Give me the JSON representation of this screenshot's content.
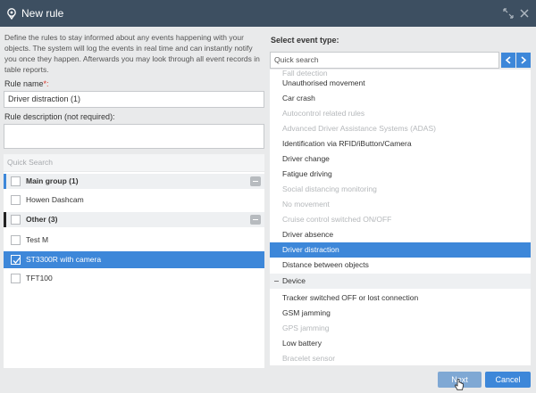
{
  "window": {
    "title": "New rule",
    "pin_icon": "location-pin-icon",
    "expand_icon": "expand-icon",
    "close_icon": "close-icon"
  },
  "description": "Define the rules to stay informed about any events happening with your objects. The system will log the events in real time and can instantly notify you once they happen. Afterwards you may look through all event records in table reports.",
  "rule_name": {
    "label": "Rule name",
    "required_mark": "*:",
    "value": "Driver distraction (1)"
  },
  "rule_description": {
    "label": "Rule description (not required):",
    "value": ""
  },
  "objects": {
    "search_placeholder": "Quick Search",
    "rows": [
      {
        "type": "group",
        "label": "Main group (1)",
        "accent": "#3d87d9"
      },
      {
        "type": "item",
        "label": "Howen Dashcam",
        "checked": false
      },
      {
        "type": "group",
        "label": "Other (3)",
        "accent": "#222222"
      },
      {
        "type": "item",
        "label": "Test M",
        "checked": false
      },
      {
        "type": "item",
        "label": "ST3300R with camera",
        "checked": true
      },
      {
        "type": "item",
        "label": "TFT100",
        "checked": false
      }
    ]
  },
  "events": {
    "heading": "Select event type:",
    "search_placeholder": "Quick search",
    "prev_icon": "chevron-left-icon",
    "next_icon": "chevron-right-icon",
    "partial_top": "Fall detection",
    "rows": [
      {
        "label": "Unauthorised movement",
        "state": "normal"
      },
      {
        "label": "Car crash",
        "state": "normal"
      },
      {
        "label": "Autocontrol related rules",
        "state": "disabled"
      },
      {
        "label": "Advanced Driver Assistance Systems (ADAS)",
        "state": "disabled"
      },
      {
        "label": "Identification via RFID/iButton/Camera",
        "state": "normal"
      },
      {
        "label": "Driver change",
        "state": "normal"
      },
      {
        "label": "Fatigue driving",
        "state": "normal"
      },
      {
        "label": "Social distancing monitoring",
        "state": "disabled"
      },
      {
        "label": "No movement",
        "state": "disabled"
      },
      {
        "label": "Cruise control switched ON/OFF",
        "state": "disabled"
      },
      {
        "label": "Driver absence",
        "state": "normal"
      },
      {
        "label": "Driver distraction",
        "state": "selected"
      },
      {
        "label": "Distance between objects",
        "state": "normal"
      },
      {
        "label": "Device",
        "state": "category"
      },
      {
        "label": "Tracker switched OFF or lost connection",
        "state": "normal"
      },
      {
        "label": "GSM jamming",
        "state": "normal"
      },
      {
        "label": "GPS jamming",
        "state": "disabled"
      },
      {
        "label": "Low battery",
        "state": "normal"
      },
      {
        "label": "Bracelet sensor",
        "state": "disabled"
      }
    ]
  },
  "buttons": {
    "next": "Next",
    "cancel": "Cancel"
  },
  "colors": {
    "header": "#3d4f61",
    "accent": "#3d87d9",
    "disabled_text": "#b5b8bb"
  }
}
